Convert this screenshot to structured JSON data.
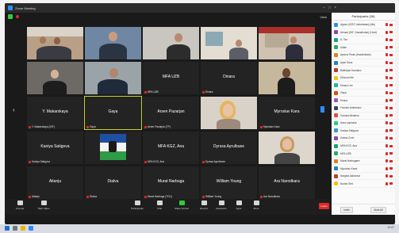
{
  "window": {
    "title": "Zoom Meeting"
  },
  "topbar": {
    "view_label": "View"
  },
  "tiles": [
    {
      "name": "",
      "label": ""
    },
    {
      "name": "",
      "label": ""
    },
    {
      "name": "",
      "label": ""
    },
    {
      "name": "",
      "label": ""
    },
    {
      "name": "",
      "label": ""
    },
    {
      "name": "",
      "label": ""
    },
    {
      "name": "",
      "label": ""
    },
    {
      "name": "MFA UZB",
      "label": "MFA UZB"
    },
    {
      "name": "Dinara",
      "label": "Dinara"
    },
    {
      "name": "",
      "label": ""
    },
    {
      "name": "Y. Makarskaya",
      "label": "Y. Makarskaya (DIF)"
    },
    {
      "name": "Gaya",
      "label": "Gaya"
    },
    {
      "name": "Arsen Pazarjan",
      "label": "Arsen Pazarjan (TP)"
    },
    {
      "name": "",
      "label": ""
    },
    {
      "name": "Myroslav Kara",
      "label": "Myroslav Kara"
    },
    {
      "name": "Kaniya Satigova",
      "label": "Kaniya Satigova"
    },
    {
      "name": "",
      "label": ""
    },
    {
      "name": "MFA KGZ, Ana",
      "label": "MFA KGZ, Ana"
    },
    {
      "name": "Dyrssa Ayrulbuee",
      "label": "Dyrssa Ayrulbuee"
    },
    {
      "name": "",
      "label": ""
    },
    {
      "name": "Aitanju",
      "label": "Aitanju"
    },
    {
      "name": "Dialva",
      "label": "Dialva"
    },
    {
      "name": "Murat Narbuga",
      "label": "Murat Narbuga (TOC)"
    },
    {
      "name": "William Young",
      "label": "William Young"
    },
    {
      "name": "Ara Narodkara",
      "label": "Ara Narodkara"
    }
  ],
  "toolbar": {
    "items": [
      "Unmute",
      "Start Video",
      "Participants",
      "Chat",
      "Share Screen",
      "Record",
      "Reactions",
      "Apps",
      "More"
    ],
    "leave": "Leave"
  },
  "panel": {
    "title": "Participants (38)",
    "participants": [
      "Agnes (ICRC Uzbekistan) (Me)",
      "Ahmad (DIF, Kazakhstan) (Host)",
      "A. Tan",
      "Aiden",
      "Aynura Pauls (Kazakhstan)",
      "Ayan Ross",
      "Bakhtiyar Kamalov",
      "Dilnoza Kim",
      "Dinara Lee",
      "Gaya",
      "Elmira",
      "Farrukh Amirbekov",
      "Gulnara Abdieva",
      "Ilona Lapinska",
      "Kaniya Satigova",
      "Karina Zorin",
      "MFA KGZ, Ana",
      "MFA UZB",
      "Murat Narbugaev",
      "Myroslav Karat",
      "Nargiza Askarova",
      "Nurlan Seit"
    ],
    "invite": "Invite",
    "mute_all": "Mute All"
  },
  "taskbar": {
    "time": "12:07"
  },
  "colors": {
    "accent": "#2d8cff",
    "muted": "#e02828",
    "active_border": "#c7d320",
    "leave": "#e02828"
  }
}
